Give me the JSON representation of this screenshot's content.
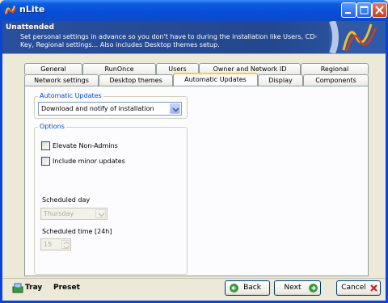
{
  "window": {
    "title": "nLite",
    "colors": {
      "titlebar": "#0a4bd0",
      "accent": "#0046d5"
    }
  },
  "banner": {
    "title": "Unattended",
    "description": "Set personal settings in advance so you don't have to during the installation like Users, CD-Key, Regional settings... Also includes Desktop themes setup."
  },
  "tabs": {
    "row1": [
      "General",
      "RunOnce",
      "Users",
      "Owner and Network ID",
      "Regional"
    ],
    "row2": [
      "Network settings",
      "Desktop themes",
      "Automatic Updates",
      "Display",
      "Components"
    ],
    "active": "Automatic Updates"
  },
  "automatic_updates": {
    "group_label": "Automatic Updates",
    "mode_value": "Download and notify of installation"
  },
  "options": {
    "group_label": "Options",
    "elevate_label": "Elevate Non-Admins",
    "elevate_checked": false,
    "minor_label": "Include minor updates",
    "minor_checked": false,
    "day_label": "Scheduled day",
    "day_value": "Thursday",
    "time_label": "Scheduled time [24h]",
    "time_value": "15"
  },
  "bottom": {
    "tray_label": "Tray",
    "preset_label": "Preset",
    "back_label": "Back",
    "next_label": "Next",
    "cancel_label": "Cancel"
  }
}
